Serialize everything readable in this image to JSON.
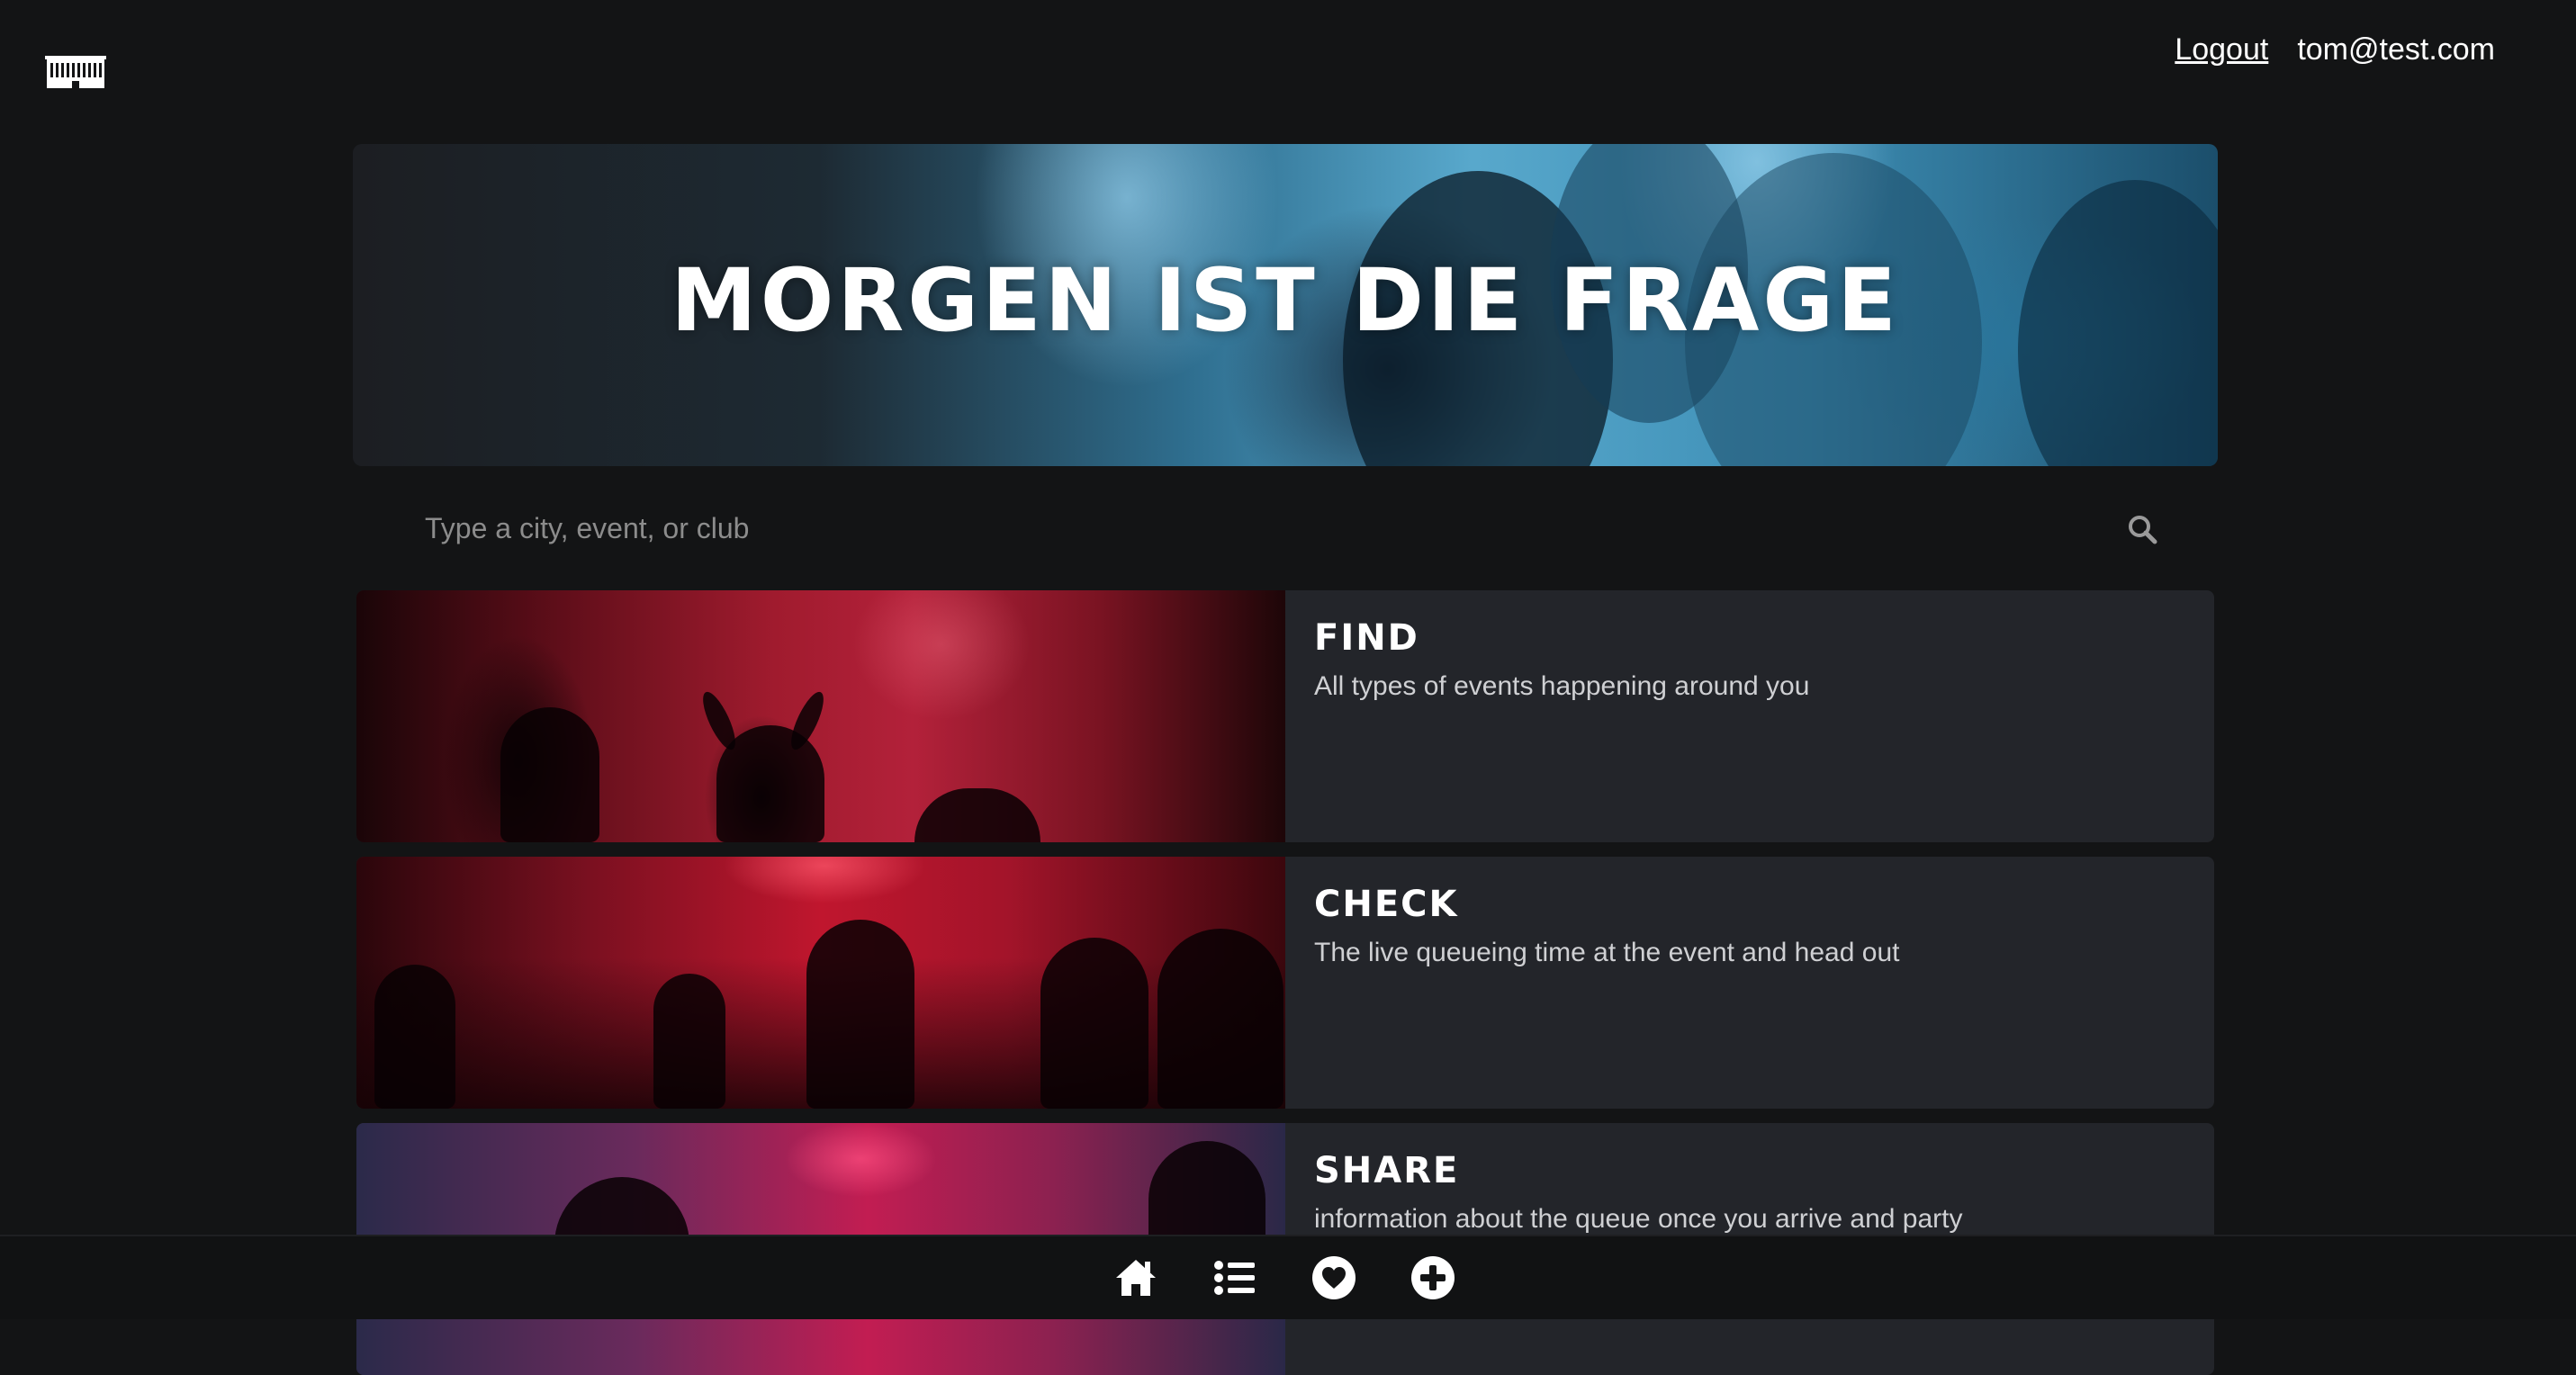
{
  "header": {
    "logo_icon": "club-building-icon",
    "logout_label": "Logout",
    "user_email": "tom@test.com"
  },
  "hero": {
    "title": "MORGEN IST DIE FRAGE"
  },
  "search": {
    "placeholder": "Type a city, event, or club",
    "value": "",
    "icon": "search-icon"
  },
  "cards": [
    {
      "title": "FIND",
      "description": "All types of events happening around you"
    },
    {
      "title": "CHECK",
      "description": "The live queueing time at the event and head out"
    },
    {
      "title": "SHARE",
      "description": "information about the queue once you arrive and party"
    }
  ],
  "bottom_nav": {
    "items": [
      "home-icon",
      "list-icon",
      "heart-icon",
      "plus-circle-icon"
    ]
  },
  "colors": {
    "background": "#131415",
    "card_background": "#23252a",
    "text": "#ffffff",
    "muted_text": "#cfd0d3"
  }
}
